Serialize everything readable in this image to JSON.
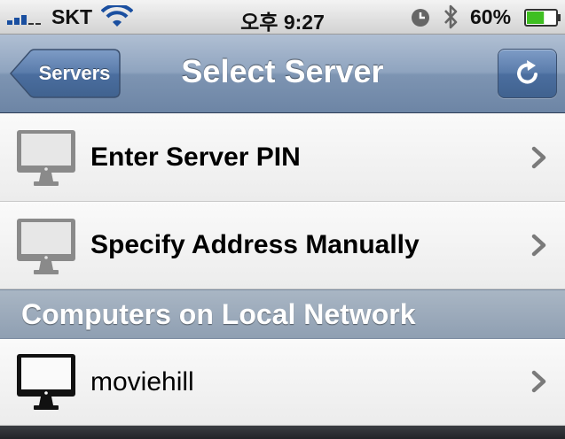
{
  "status_bar": {
    "carrier": "SKT",
    "time": "오후 9:27",
    "battery_percent_label": "60%",
    "battery_level": 0.6,
    "signal_bars": 3,
    "icons": [
      "signal-bars-icon",
      "wifi-icon",
      "clock-icon",
      "bluetooth-icon",
      "battery-icon"
    ]
  },
  "nav": {
    "back_label": "Servers",
    "title": "Select Server",
    "refresh_icon": "refresh-icon"
  },
  "menu": [
    {
      "label": "Enter Server PIN",
      "icon": "monitor-icon"
    },
    {
      "label": "Specify Address Manually",
      "icon": "monitor-icon"
    }
  ],
  "section": {
    "title": "Computers on Local Network",
    "computers": [
      {
        "name": "moviehill",
        "icon": "monitor-icon"
      }
    ]
  },
  "colors": {
    "nav_bar": "#7d94b2",
    "refresh_button": "#4b6e9f",
    "section_header": "#8f9fb2",
    "battery_fill": "#3fbf22"
  }
}
